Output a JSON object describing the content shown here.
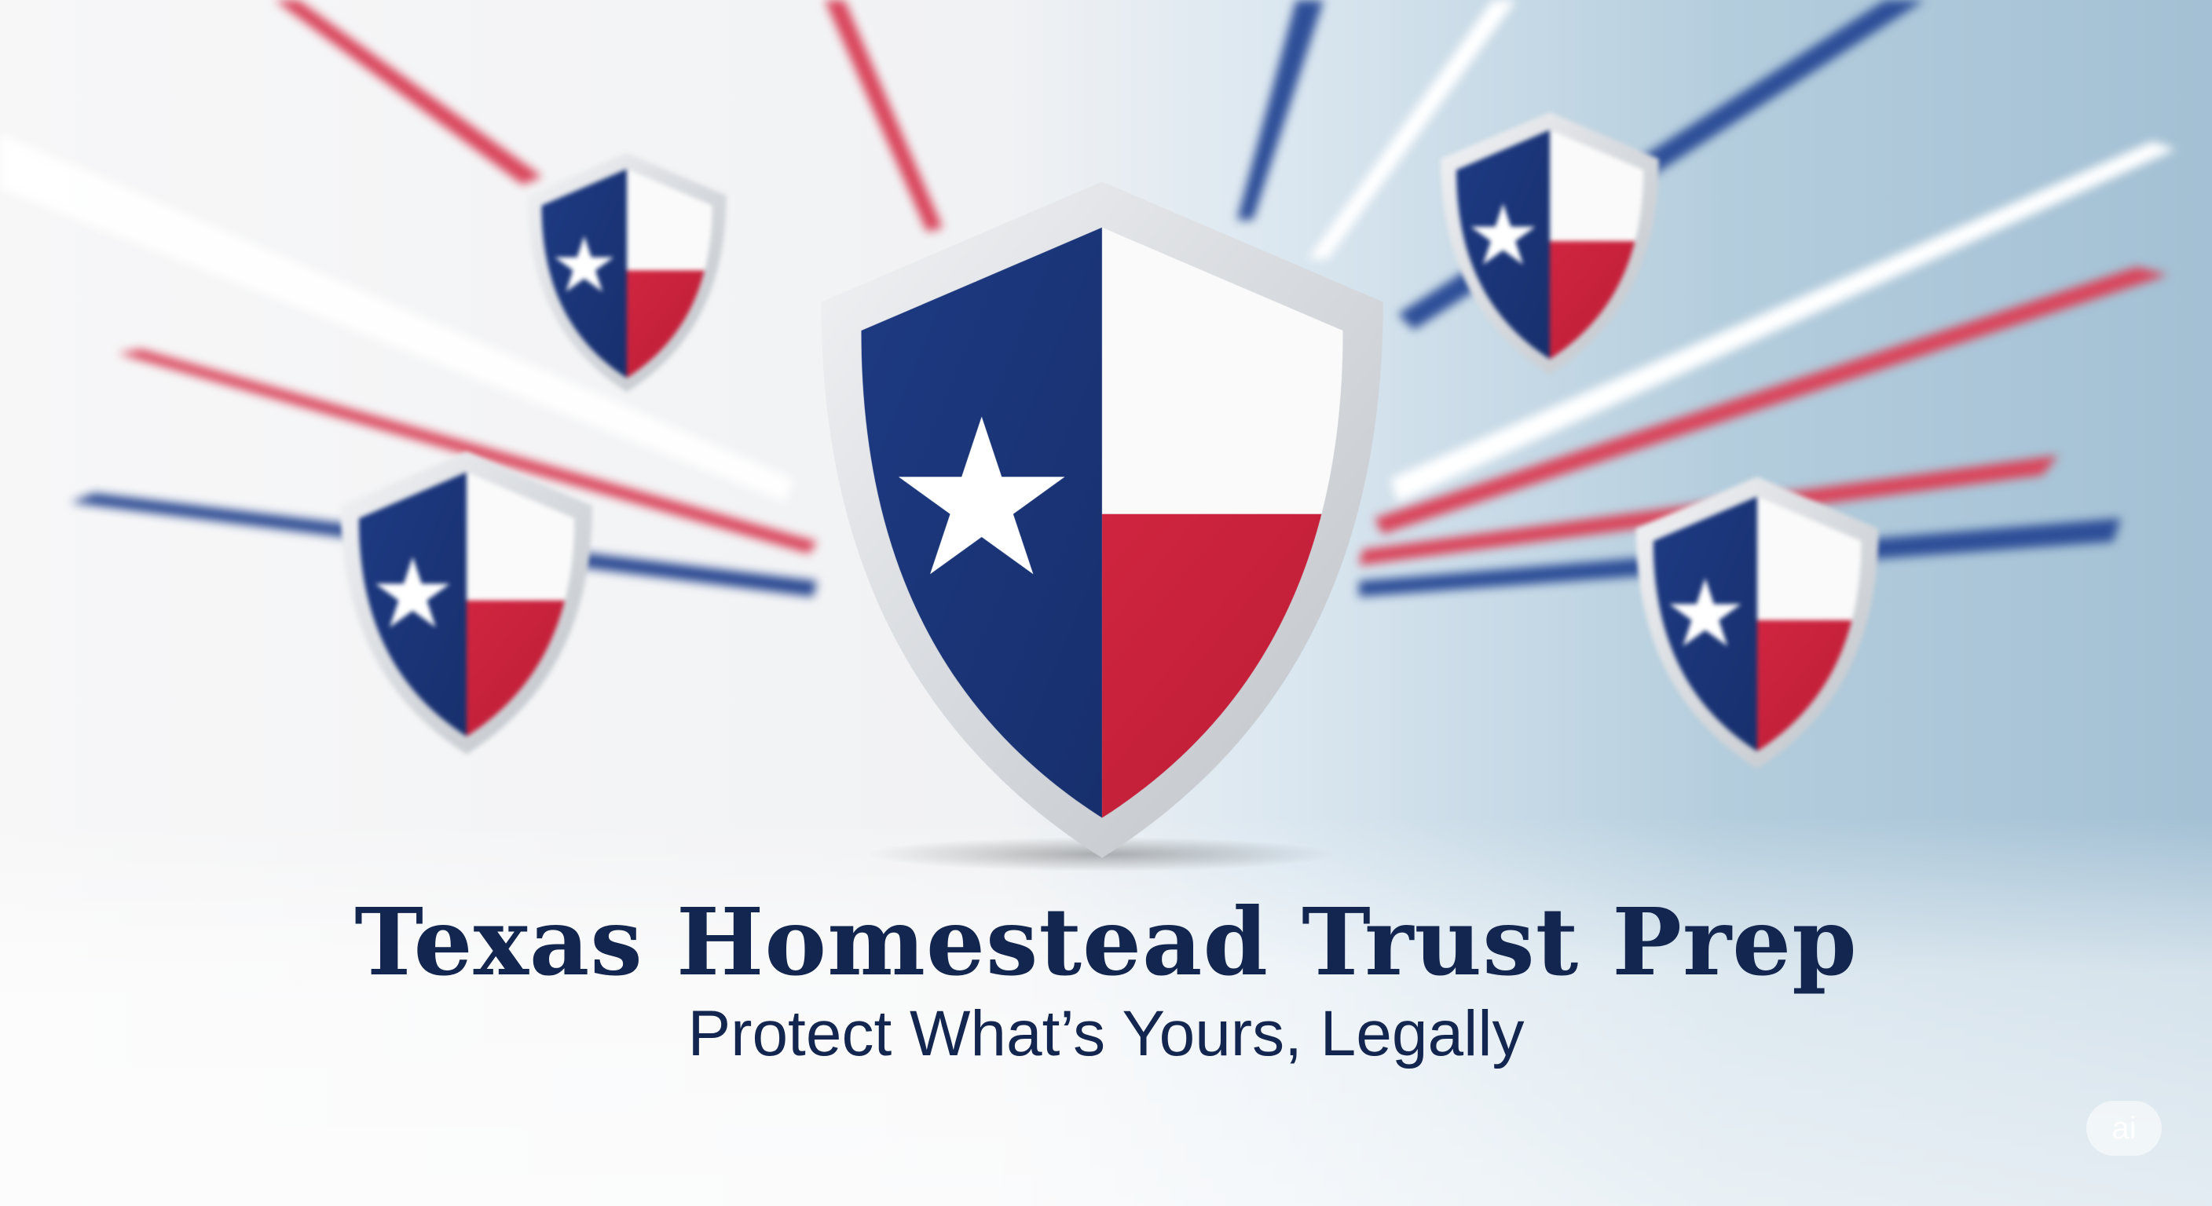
{
  "colors": {
    "navy": "#1e3a7f",
    "red": "#c8213a",
    "white": "#ffffff",
    "silver": "#d8dbe0",
    "text": "#13264f"
  },
  "title": "Texas Homestead Trust Prep",
  "subtitle": "Protect What’s Yours, Legally",
  "badge": "ai",
  "icons": [
    "texas-flag-shield-icon",
    "star-icon"
  ]
}
